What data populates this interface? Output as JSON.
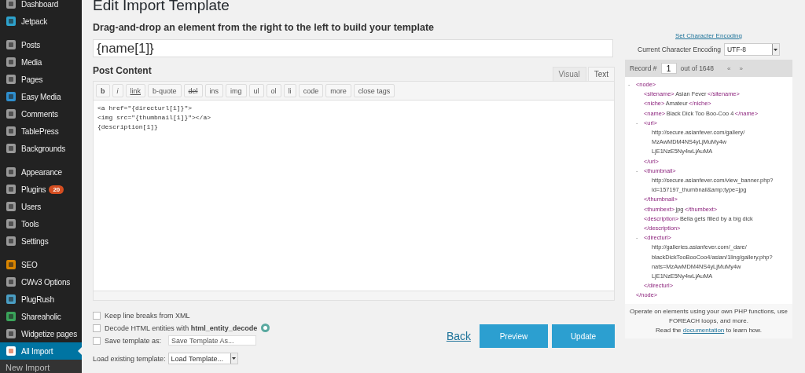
{
  "sidebar": {
    "groups": [
      {
        "items": [
          {
            "label": "Dashboard",
            "selected": false
          },
          {
            "label": "Jetpack",
            "selected": false
          }
        ]
      },
      {
        "items": [
          {
            "label": "Posts",
            "selected": false
          },
          {
            "label": "Media",
            "selected": false
          },
          {
            "label": "Pages",
            "selected": false
          },
          {
            "label": "Easy Media",
            "selected": false
          },
          {
            "label": "Comments",
            "selected": false
          },
          {
            "label": "TablePress",
            "selected": false
          },
          {
            "label": "Backgrounds",
            "selected": false
          }
        ]
      },
      {
        "items": [
          {
            "label": "Appearance",
            "selected": false
          },
          {
            "label": "Plugins",
            "selected": false,
            "badge": "20"
          },
          {
            "label": "Users",
            "selected": false
          },
          {
            "label": "Tools",
            "selected": false
          },
          {
            "label": "Settings",
            "selected": false
          }
        ]
      },
      {
        "items": [
          {
            "label": "SEO",
            "selected": false
          },
          {
            "label": "CWv3 Options",
            "selected": false
          },
          {
            "label": "PlugRush",
            "selected": false
          },
          {
            "label": "Shareaholic",
            "selected": false
          },
          {
            "label": "Widgetize pages",
            "selected": false
          },
          {
            "label": "All Import",
            "selected": true
          }
        ]
      }
    ],
    "submenu": [
      {
        "label": "New Import"
      }
    ]
  },
  "page": {
    "title": "Edit Import Template",
    "instruction": "Drag-and-drop an element from the right to the left to build your template",
    "title_value": "{name[1]}"
  },
  "editor": {
    "label": "Post Content",
    "tabs": [
      {
        "label": "Visual",
        "selected": false
      },
      {
        "label": "Text",
        "selected": true
      }
    ],
    "toolbar": [
      "b",
      "i",
      "link",
      "b-quote",
      "del",
      "ins",
      "img",
      "ul",
      "ol",
      "li",
      "code",
      "more",
      "close tags"
    ],
    "content": "<a href=\"{directurl[1]}\">\n<img src=\"{thumbnail[1]}\"></a>\n{description[1]}"
  },
  "options": [
    {
      "label": "Keep line breaks from XML",
      "checked": false
    },
    {
      "label": "Decode HTML entities with **html_entity_decode**",
      "checked": false,
      "help": true
    },
    {
      "label": "Save template as:",
      "checked": false,
      "field_placeholder": "Save Template As..."
    }
  ],
  "load_template": {
    "label": "Load existing template:",
    "value": "Load Template..."
  },
  "actions": {
    "back": "Back",
    "buttons": [
      "Preview",
      "Update"
    ]
  },
  "encoding": {
    "link": "Set Character Encoding",
    "label": "Current Character Encoding",
    "value": "UTF-8"
  },
  "record": {
    "label": "Record #",
    "value": "1",
    "total": "out of 1648",
    "prev": "«",
    "next": "»",
    "tree": {
      "toggle": "-",
      "open": "<node>",
      "close": "</node>",
      "children": [
        {
          "open": "<sitename>",
          "value": "Asian Fever",
          "close": "</sitename>"
        },
        {
          "open": "<niche>",
          "value": "Amateur",
          "close": "</niche>"
        },
        {
          "open": "<name>",
          "value": "Black Dick Too Boo-Coo 4",
          "close": "</name>"
        },
        {
          "toggle": "-",
          "open": "<url>",
          "lines": [
            "http://secure.asianfever.com/gallery/",
            "MzAwMDM4NS4yLjMuMy4w",
            "LjE1NzE5Ny4wLjAuMA"
          ],
          "close": "</url>"
        },
        {
          "toggle": "-",
          "open": "<thumbnail>",
          "lines": [
            "http://secure.asianfever.com/view_banner.php?",
            "id=157197_thumbnail&amp;type=jpg"
          ],
          "close": "</thumbnail>"
        },
        {
          "open": "<thumbext>",
          "value": "jpg",
          "close": "</thumbext>"
        },
        {
          "open": "<description>",
          "value": "Bella gets filled by a big dick",
          "close": "</description>",
          "close_below": true
        },
        {
          "toggle": "-",
          "open": "<directurl>",
          "lines": [
            "http://galleries.asianfever.com/_dare/",
            "blackDickTooBooCoo4/asian/1ling/gallery.php?",
            "nats=MzAwMDM4NS4yLjMuMy4w",
            "LjE1NzE5Ny4wLjAuMA"
          ],
          "close": "</directurl>"
        }
      ]
    },
    "footer_lines": [
      "Operate on elements using your own PHP functions, use FOREACH loops, and more."
    ],
    "footer_read": "Read the",
    "footer_link": "documentation",
    "footer_end": "to learn how."
  }
}
